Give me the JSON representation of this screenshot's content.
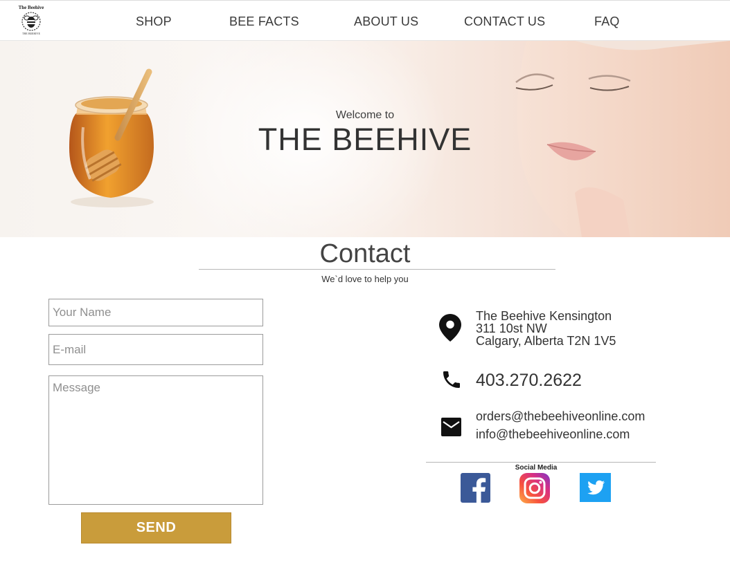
{
  "nav": {
    "logo_title": "The Beehive",
    "logo_caption": "THE BEEHIVE",
    "items": [
      "SHOP",
      "BEE FACTS",
      "ABOUT US",
      "CONTACT US",
      "FAQ"
    ]
  },
  "hero": {
    "welcome": "Welcome to",
    "title": "THE BEEHIVE"
  },
  "contact": {
    "title": "Contact",
    "subtitle": "We`d love to help you"
  },
  "form": {
    "name_placeholder": "Your Name",
    "email_placeholder": "E-mail",
    "message_placeholder": "Message",
    "send_label": "SEND"
  },
  "info": {
    "address": [
      "The Beehive Kensington",
      "311 10st NW",
      "Calgary, Alberta T2N 1V5"
    ],
    "phone": "403.270.2622",
    "emails": [
      "orders@thebeehiveonline.com",
      "info@thebeehiveonline.com"
    ],
    "icons": [
      "location-pin-icon",
      "phone-icon",
      "mail-icon"
    ]
  },
  "social": {
    "label": "Social Media",
    "networks": [
      "facebook",
      "instagram",
      "twitter"
    ]
  },
  "colors": {
    "send_button": "#c99c3b",
    "facebook": "#3b5998",
    "twitter": "#1da1f2",
    "text": "#333333"
  }
}
